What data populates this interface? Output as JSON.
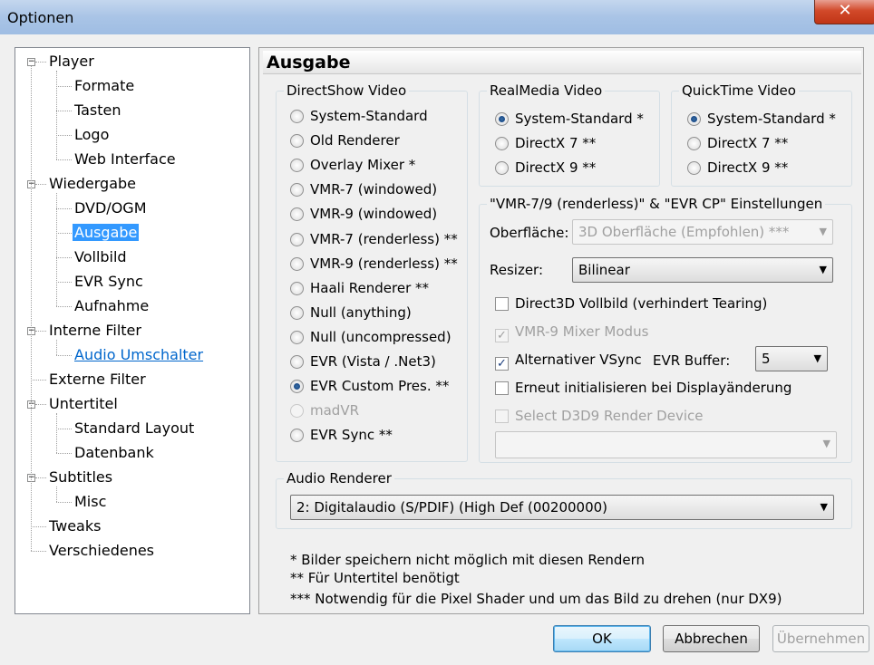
{
  "window": {
    "title": "Optionen",
    "close_symbol": "✕"
  },
  "tree": {
    "items": [
      {
        "label": "Player",
        "level": 0,
        "expander": "−"
      },
      {
        "label": "Formate",
        "level": 1
      },
      {
        "label": "Tasten",
        "level": 1
      },
      {
        "label": "Logo",
        "level": 1
      },
      {
        "label": "Web Interface",
        "level": 1
      },
      {
        "label": "Wiedergabe",
        "level": 0,
        "expander": "−"
      },
      {
        "label": "DVD/OGM",
        "level": 1
      },
      {
        "label": "Ausgabe",
        "level": 1,
        "selected": true
      },
      {
        "label": "Vollbild",
        "level": 1
      },
      {
        "label": "EVR Sync",
        "level": 1
      },
      {
        "label": "Aufnahme",
        "level": 1
      },
      {
        "label": "Interne Filter",
        "level": 0,
        "expander": "−"
      },
      {
        "label": "Audio Umschalter",
        "level": 1,
        "link": true
      },
      {
        "label": "Externe Filter",
        "level": 0
      },
      {
        "label": "Untertitel",
        "level": 0,
        "expander": "−"
      },
      {
        "label": "Standard Layout",
        "level": 1
      },
      {
        "label": "Datenbank",
        "level": 1
      },
      {
        "label": "Subtitles",
        "level": 0,
        "expander": "−"
      },
      {
        "label": "Misc",
        "level": 1
      },
      {
        "label": "Tweaks",
        "level": 0
      },
      {
        "label": "Verschiedenes",
        "level": 0
      }
    ]
  },
  "page": {
    "title": "Ausgabe",
    "directshow": {
      "label": "DirectShow Video",
      "options": [
        {
          "label": "System-Standard",
          "checked": false,
          "enabled": true
        },
        {
          "label": "Old Renderer",
          "checked": false,
          "enabled": true
        },
        {
          "label": "Overlay Mixer *",
          "checked": false,
          "enabled": true
        },
        {
          "label": "VMR-7 (windowed)",
          "checked": false,
          "enabled": true
        },
        {
          "label": "VMR-9 (windowed)",
          "checked": false,
          "enabled": true
        },
        {
          "label": "VMR-7 (renderless) **",
          "checked": false,
          "enabled": true
        },
        {
          "label": "VMR-9 (renderless) **",
          "checked": false,
          "enabled": true
        },
        {
          "label": "Haali Renderer **",
          "checked": false,
          "enabled": true
        },
        {
          "label": "Null (anything)",
          "checked": false,
          "enabled": true
        },
        {
          "label": "Null (uncompressed)",
          "checked": false,
          "enabled": true
        },
        {
          "label": "EVR (Vista / .Net3)",
          "checked": false,
          "enabled": true
        },
        {
          "label": "EVR Custom Pres. **",
          "checked": true,
          "enabled": true
        },
        {
          "label": "madVR",
          "checked": false,
          "enabled": false
        },
        {
          "label": "EVR Sync **",
          "checked": false,
          "enabled": true
        }
      ]
    },
    "realmedia": {
      "label": "RealMedia Video",
      "options": [
        {
          "label": "System-Standard *",
          "checked": true
        },
        {
          "label": "DirectX 7 **",
          "checked": false
        },
        {
          "label": "DirectX 9 **",
          "checked": false
        }
      ]
    },
    "quicktime": {
      "label": "QuickTime Video",
      "options": [
        {
          "label": "System-Standard *",
          "checked": true
        },
        {
          "label": "DirectX 7 **",
          "checked": false
        },
        {
          "label": "DirectX 9 **",
          "checked": false
        }
      ]
    },
    "vmr_settings": {
      "label": "\"VMR-7/9 (renderless)\" & \"EVR CP\" Einstellungen",
      "surface_label": "Oberfläche:",
      "surface_value": "3D Oberfläche (Empfohlen) ***",
      "resizer_label": "Resizer:",
      "resizer_value": "Bilinear",
      "d3d_fullscreen": {
        "label": "Direct3D Vollbild (verhindert Tearing)",
        "checked": false
      },
      "vmr9_mixer": {
        "label": "VMR-9 Mixer Modus",
        "checked": true
      },
      "alt_vsync": {
        "label": "Alternativer VSync",
        "checked": true
      },
      "evr_buffer_label": "EVR Buffer:",
      "evr_buffer_value": "5",
      "reinit": {
        "label": "Erneut initialisieren bei Displayänderung",
        "checked": false
      },
      "select_d3d9": {
        "label": "Select D3D9 Render Device",
        "checked": false
      },
      "device_value": ""
    },
    "audio": {
      "label": "Audio Renderer",
      "value": "2: Digitalaudio (S/PDIF) (High Def (00200000)"
    },
    "notes": [
      "* Bilder speichern nicht möglich mit diesen Rendern",
      "** Für Untertitel benötigt",
      "*** Notwendig für die Pixel Shader und um das Bild zu drehen (nur DX9)"
    ]
  },
  "buttons": {
    "ok": "OK",
    "cancel": "Abbrechen",
    "apply": "Übernehmen"
  },
  "icons": {
    "dropdown": "▼",
    "check": "✓"
  }
}
